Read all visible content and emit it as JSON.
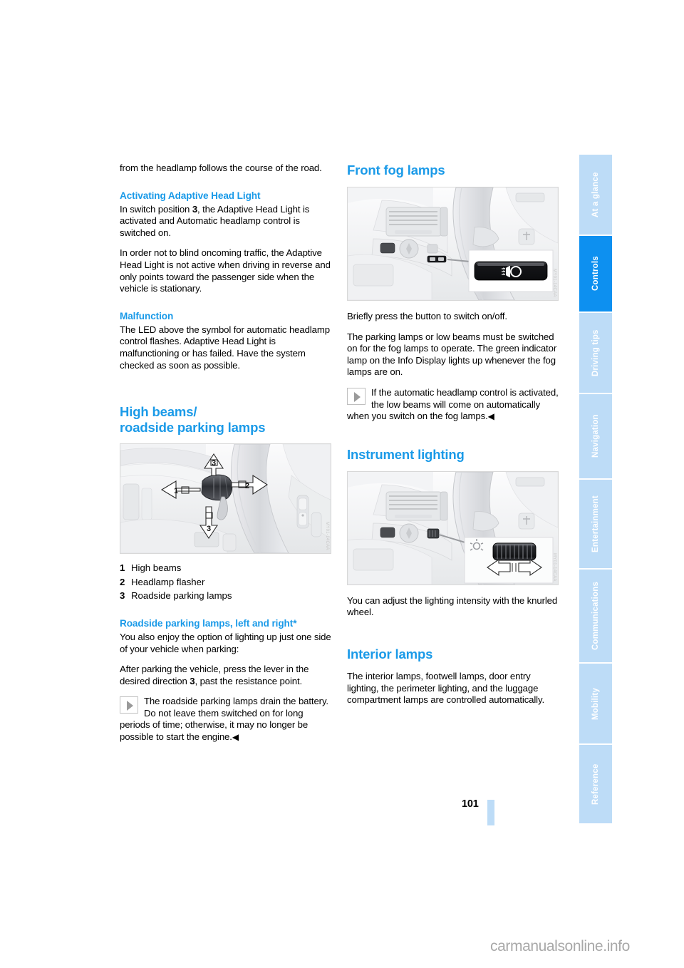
{
  "page": {
    "number": "101",
    "watermark": "carmanualsonline.info"
  },
  "colors": {
    "heading_blue": "#1a9ae8",
    "tab_active_blue": "#0d90f0",
    "tab_inactive_blue": "#bddcf7"
  },
  "left_column": {
    "continued_paragraph": "from the headlamp follows the course of the road.",
    "sub_heading_activating": "Activating Adaptive Head Light",
    "activating_p1_a": "In switch position ",
    "activating_p1_num": "3",
    "activating_p1_b": ", the Adaptive Head Light is activated and Automatic headlamp control is switched on.",
    "activating_p2": "In order not to blind oncoming traffic, the Adaptive Head Light is not active when driving in reverse and only points toward the passenger side when the vehicle is stationary.",
    "sub_heading_malfunction": "Malfunction",
    "malfunction_p1": "The LED above the symbol for automatic headlamp control flashes. Adaptive Head Light is malfunctioning or has failed. Have the system checked as soon as possible.",
    "section_heading_high_beams_line1": "High beams/",
    "section_heading_high_beams_line2": "roadside parking lamps",
    "figure_stalk_code": "MY01-14CAA",
    "legend": [
      {
        "n": "1",
        "label": "High beams"
      },
      {
        "n": "2",
        "label": "Headlamp flasher"
      },
      {
        "n": "3",
        "label": "Roadside parking lamps"
      }
    ],
    "sub_heading_roadside": "Roadside parking lamps, left and right*",
    "roadside_p1": "You also enjoy the option of lighting up just one side of your vehicle when parking:",
    "roadside_p2_a": "After parking the vehicle, press the lever in the desired direction ",
    "roadside_p2_num": "3",
    "roadside_p2_b": ", past the resistance point.",
    "note_icon": "note-triangle-icon",
    "note_text": "The roadside parking lamps drain the battery. Do not leave them switched on for long periods of time; otherwise, it may no longer be possible to start the engine.",
    "note_endmark": "◀"
  },
  "right_column": {
    "section_heading_fog": "Front fog lamps",
    "figure_fog_code": "MY01-14CAA",
    "fog_p1": "Briefly press the button to switch on/off.",
    "fog_p2": "The parking lamps or low beams must be switched on for the fog lamps to operate. The green indicator lamp on the Info Display lights up whenever the fog lamps are on.",
    "note_icon": "note-triangle-icon",
    "fog_note_text": "If the automatic headlamp control is activated, the low beams will come on automatically when you switch on the fog lamps.",
    "note_endmark": "◀",
    "section_heading_instrument": "Instrument lighting",
    "figure_instrument_code": "MY01-14CAA",
    "instrument_p1": "You can adjust the lighting intensity with the knurled wheel.",
    "section_heading_interior": "Interior lamps",
    "interior_p1": "The interior lamps, footwell lamps, door entry lighting, the perimeter lighting, and the luggage compartment lamps are controlled automatically."
  },
  "sidebar": {
    "tabs": [
      {
        "label": "At a glance",
        "active": false
      },
      {
        "label": "Controls",
        "active": true
      },
      {
        "label": "Driving tips",
        "active": false
      },
      {
        "label": "Navigation",
        "active": false
      },
      {
        "label": "Entertainment",
        "active": false
      },
      {
        "label": "Communications",
        "active": false
      },
      {
        "label": "Mobility",
        "active": false
      },
      {
        "label": "Reference",
        "active": false
      }
    ]
  }
}
